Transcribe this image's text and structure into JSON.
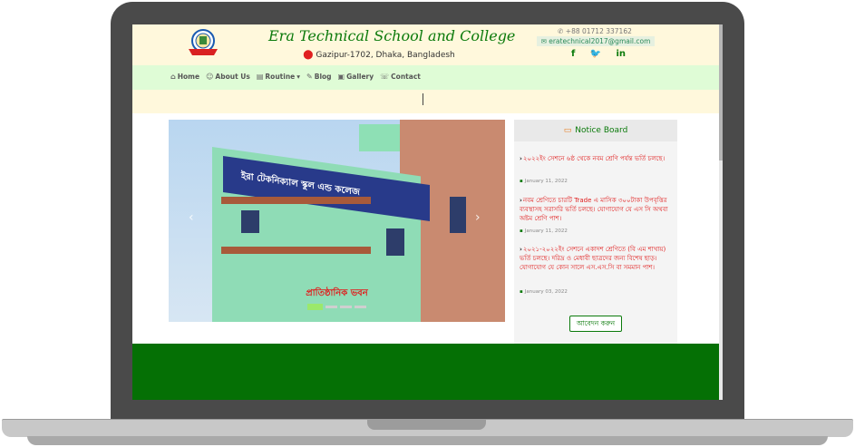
{
  "header": {
    "title": "Era Technical School and College",
    "address": "Gazipur-1702, Dhaka, Bangladesh",
    "phone": "+88 01712 337162",
    "email": "eratechnical2017@gmail.com",
    "socials": [
      "facebook-icon",
      "twitter-icon",
      "linkedin-icon"
    ]
  },
  "nav": {
    "items": [
      {
        "icon": "home-icon",
        "label": "Home"
      },
      {
        "icon": "user-icon",
        "label": "About Us"
      },
      {
        "icon": "file-icon",
        "label": "Routine"
      },
      {
        "icon": "edit-icon",
        "label": "Blog"
      },
      {
        "icon": "image-icon",
        "label": "Gallery"
      },
      {
        "icon": "contact-icon",
        "label": "Contact"
      }
    ]
  },
  "slider": {
    "banner_text": "ইরা টেকনিক্যাল স্কুল এন্ড কলেজ",
    "caption": "প্রাতিষ্ঠানিক ভবন",
    "active_slide": 1,
    "slide_count": 4
  },
  "notice_board": {
    "title": "Notice Board",
    "items": [
      {
        "text": "২০২২ইং সেশনে ৬ষ্ঠ থেকে নবম শ্রেণি পর্যন্ত ভর্তি চলছে।",
        "date": "January 11, 2022"
      },
      {
        "text": "নবম শ্রেণিতে চারটি Trade এ মাসিক ৩০০টাকা উপবৃত্তির ব্যবস্থাসহ সরাসরি ভর্তি চলছে। যোগাযোগ যে এস সি অথবা অষ্টম শ্রেণি পাশ।",
        "date": "January 11, 2022"
      },
      {
        "text": "২০২১-২০২২ইং সেশনে একাদশ শ্রেণিতে (বি এম শাখায়) ভর্তি চলছে। দরিদ্র ও মেধাবী ছাত্রদের জন্য বিশেষ ছাড়। যোগাযোগ যে কোন সালে এস.এস.সি বা সমমান পাশ।",
        "date": "January 03, 2022"
      }
    ],
    "apply_label": "আবেদন করুন"
  },
  "colors": {
    "brand_green": "#057005",
    "header_bg": "#fff8dc",
    "nav_bg": "#dffcd6",
    "notice_red": "#e01c1c"
  }
}
